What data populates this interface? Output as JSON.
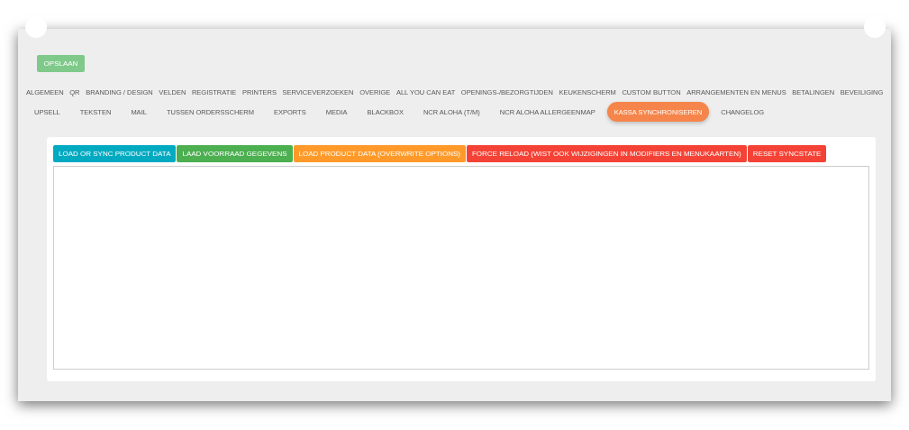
{
  "save_button": "OPSLAAN",
  "tabs": [
    [
      {
        "label": "ALGEMEEN",
        "selected": false
      },
      {
        "label": "QR",
        "selected": false
      },
      {
        "label": "BRANDING / DESIGN",
        "selected": false
      },
      {
        "label": "VELDEN",
        "selected": false
      },
      {
        "label": "REGISTRATIE",
        "selected": false
      },
      {
        "label": "PRINTERS",
        "selected": false
      },
      {
        "label": "SERVICEVERZOEKEN",
        "selected": false
      },
      {
        "label": "OVERIGE",
        "selected": false
      },
      {
        "label": "ALL YOU CAN EAT",
        "selected": false
      },
      {
        "label": "OPENINGS-/BEZORGTIJDEN",
        "selected": false
      },
      {
        "label": "KEUKENSCHERM",
        "selected": false
      },
      {
        "label": "CUSTOM BUTTON",
        "selected": false
      },
      {
        "label": "ARRANGEMENTEN EN MENUS",
        "selected": false
      },
      {
        "label": "BETALINGEN",
        "selected": false
      },
      {
        "label": "BEVEILIGING",
        "selected": false
      }
    ],
    [
      {
        "label": "UPSELL",
        "selected": false
      },
      {
        "label": "TEKSTEN",
        "selected": false
      },
      {
        "label": "MAIL",
        "selected": false
      },
      {
        "label": "TUSSEN ORDERSSCHERM",
        "selected": false
      },
      {
        "label": "EXPORTS",
        "selected": false
      },
      {
        "label": "MEDIA",
        "selected": false
      },
      {
        "label": "BLACKBOX",
        "selected": false
      },
      {
        "label": "NCR ALOHA (T/M)",
        "selected": false
      },
      {
        "label": "NCR ALOHA ALLERGEENMAP",
        "selected": false
      },
      {
        "label": "KASSA SYNCHRONISEREN",
        "selected": true
      },
      {
        "label": "CHANGELOG",
        "selected": false
      }
    ]
  ],
  "actions": [
    {
      "label": "LOAD OR SYNC PRODUCT DATA",
      "color": "#00aac1"
    },
    {
      "label": "LAAD VOORRAAD GEGEVENS",
      "color": "#4caf50"
    },
    {
      "label": "LOAD PRODUCT DATA (OVERWRITE OPTIONS)",
      "color": "#ff9a2a"
    },
    {
      "label": "FORCE RELOAD (WIST OOK WIJZIGINGEN IN MODIFIERS EN MENUKAARTEN)",
      "color": "#f44336"
    },
    {
      "label": "RESET SYNCSTATE",
      "color": "#f44336"
    }
  ]
}
